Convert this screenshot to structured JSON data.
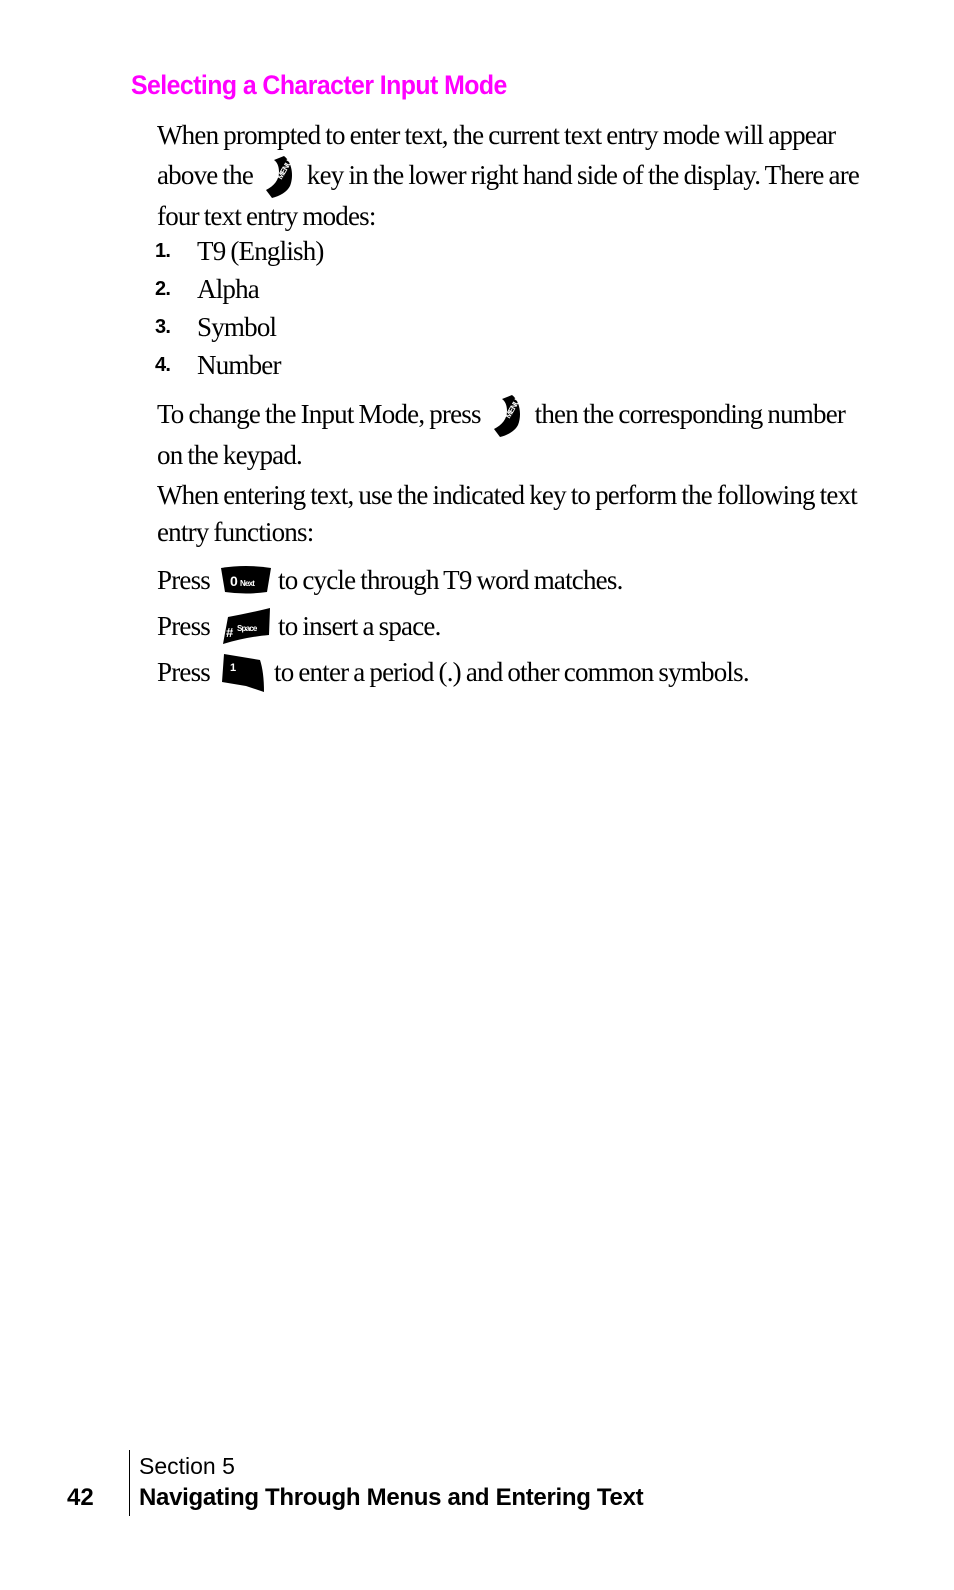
{
  "heading": "Selecting a Character Input Mode",
  "intro": {
    "before_key": "When prompted to enter text, the current text entry mode will appear above the",
    "key_icon": "menu-key-icon",
    "key_label": "MENU",
    "after_key": "key in the lower right hand side of the display. There are four text entry modes:"
  },
  "modes": [
    {
      "number": "1.",
      "label": "T9 (English)"
    },
    {
      "number": "2.",
      "label": "Alpha"
    },
    {
      "number": "3.",
      "label": "Symbol"
    },
    {
      "number": "4.",
      "label": "Number"
    }
  ],
  "change_mode": {
    "before_key": "To change the Input Mode, press",
    "key_label": "MENU",
    "after_key": "then the corresponding number on the keypad."
  },
  "functions_intro": "When entering text, use the indicated key to perform the following text entry functions:",
  "functions": [
    {
      "press": "Press",
      "key_main": "0",
      "key_sub": "Next",
      "key_icon": "zero-next-key-icon",
      "description": "to cycle through T9 word matches."
    },
    {
      "press": "Press",
      "key_main": "#",
      "key_sub": "Space",
      "key_icon": "hash-space-key-icon",
      "description": "to insert a space."
    },
    {
      "press": "Press",
      "key_main": "1",
      "key_sub": "",
      "key_icon": "one-key-icon",
      "description": "to enter a period (.) and other common symbols."
    }
  ],
  "footer": {
    "page_number": "42",
    "section": "Section 5",
    "title": "Navigating Through Menus and Entering Text"
  },
  "colors": {
    "heading": "#ff00ff",
    "text": "#000000"
  }
}
